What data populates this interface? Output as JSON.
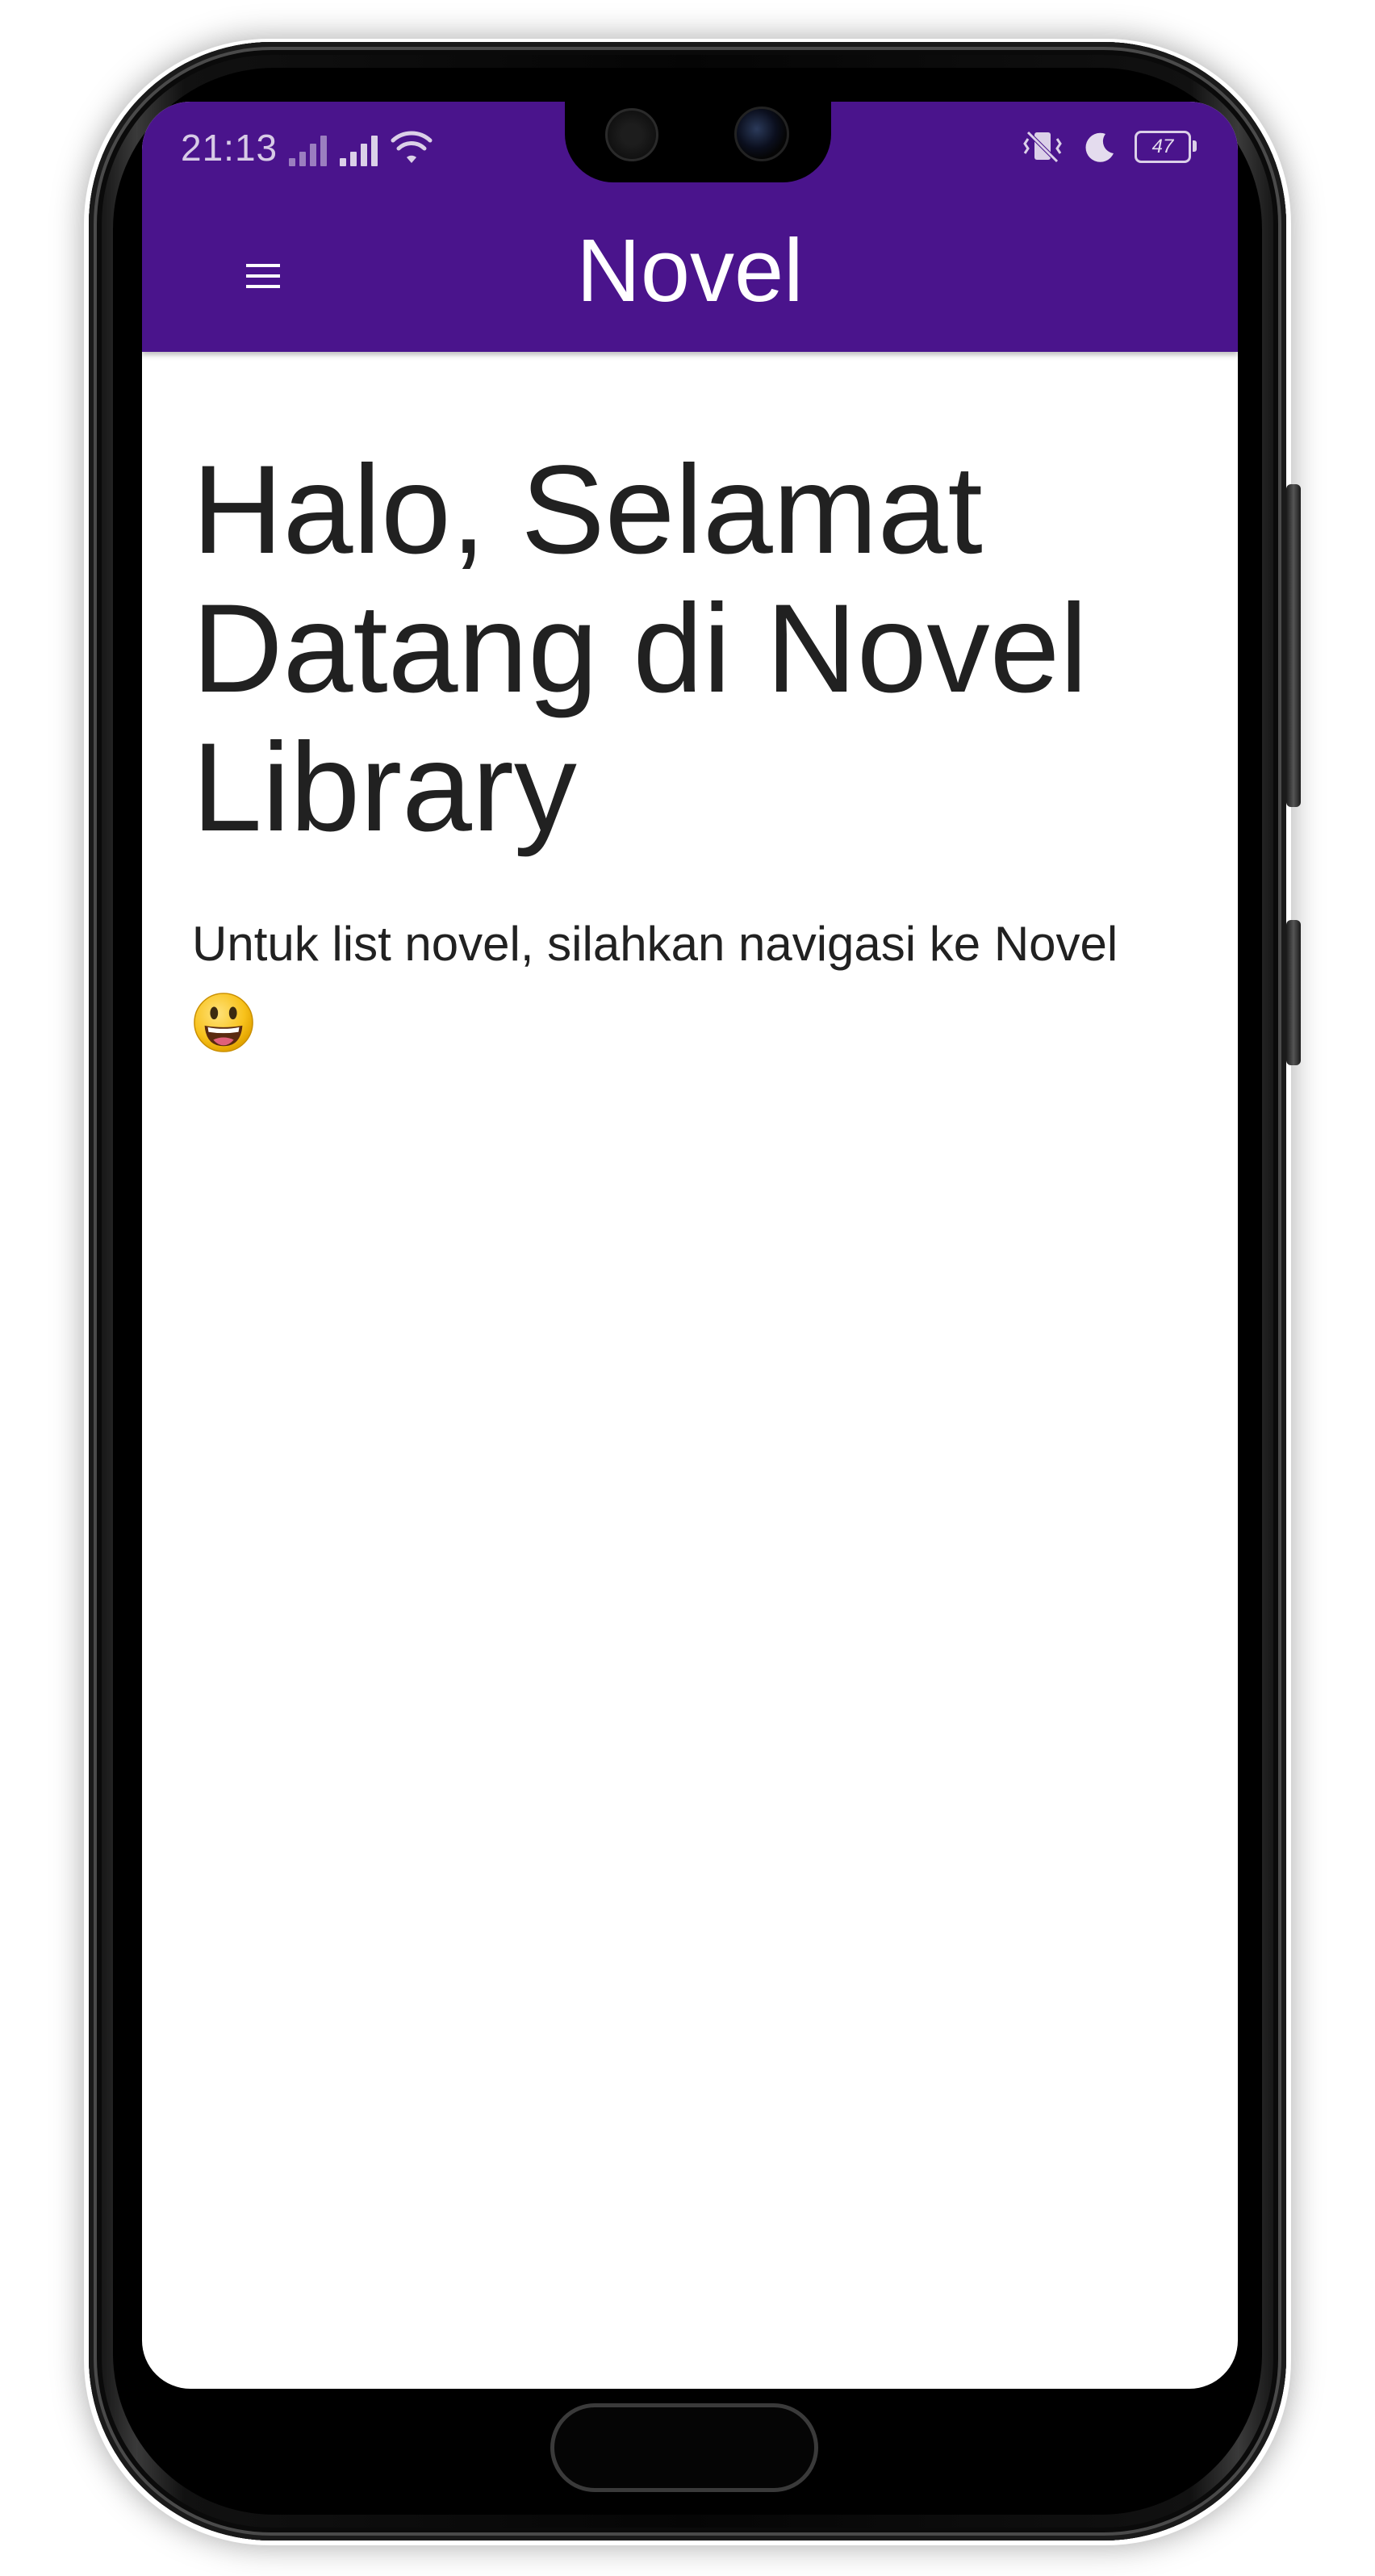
{
  "status_bar": {
    "time": "21:13",
    "battery": "47",
    "icons": [
      "no-sim-signal-icon",
      "signal-icon",
      "wifi-icon",
      "vibrate-icon",
      "moon-icon",
      "battery-icon"
    ]
  },
  "app_bar": {
    "title": "Novel",
    "menu_icon": "hamburger-menu-icon",
    "background_color": "#4a148c"
  },
  "main": {
    "heading": "Halo, Selamat Datang di Novel Library",
    "body": "Untuk list novel, silahkan navigasi ke Novel",
    "emoji": "grinning-face-emoji"
  }
}
